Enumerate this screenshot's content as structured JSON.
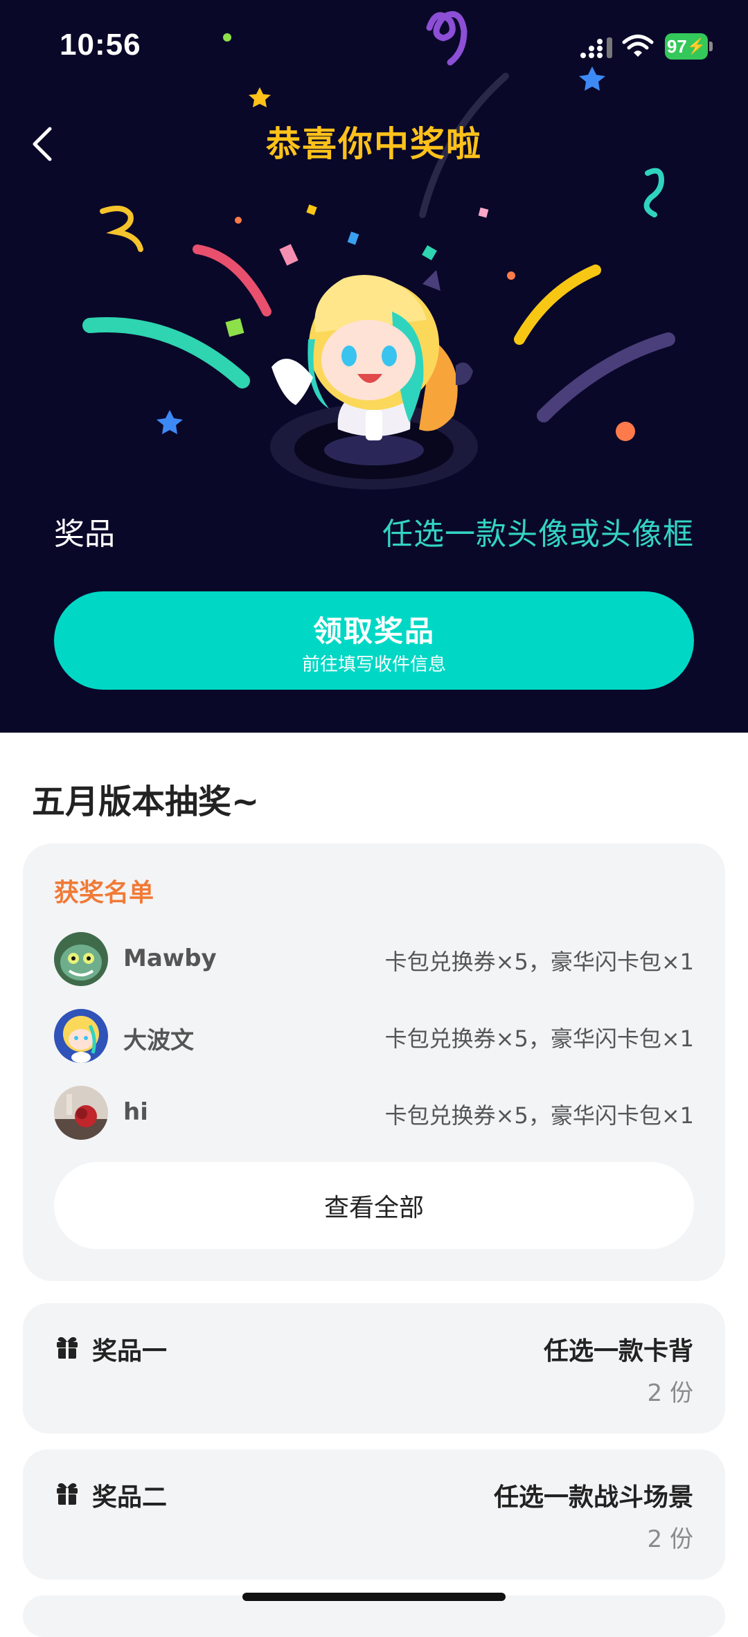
{
  "status_bar": {
    "time": "10:56",
    "battery": "97"
  },
  "hero": {
    "title": "恭喜你中奖啦",
    "prize_label": "奖品",
    "prize_value": "任选一款头像或头像框",
    "claim_button": {
      "label": "领取奖品",
      "sublabel": "前往填写收件信息"
    }
  },
  "section_title": "五月版本抽奖~",
  "winners": {
    "title": "获奖名单",
    "items": [
      {
        "name": "Mawby",
        "prize": "卡包兑换券×5，豪华闪卡包×1"
      },
      {
        "name": "大波文",
        "prize": "卡包兑换券×5，豪华闪卡包×1"
      },
      {
        "name": "hi",
        "prize": "卡包兑换券×5，豪华闪卡包×1"
      }
    ],
    "view_all": "查看全部"
  },
  "prizes": [
    {
      "name": "奖品一",
      "desc": "任选一款卡背",
      "qty": "2 份"
    },
    {
      "name": "奖品二",
      "desc": "任选一款战斗场景",
      "qty": "2 份"
    }
  ],
  "colors": {
    "hero_bg": "#0a0829",
    "title_gold": "#ffc21a",
    "accent_teal": "#00d8c5",
    "prize_teal": "#33d4c4",
    "winners_orange": "#f07a36"
  }
}
